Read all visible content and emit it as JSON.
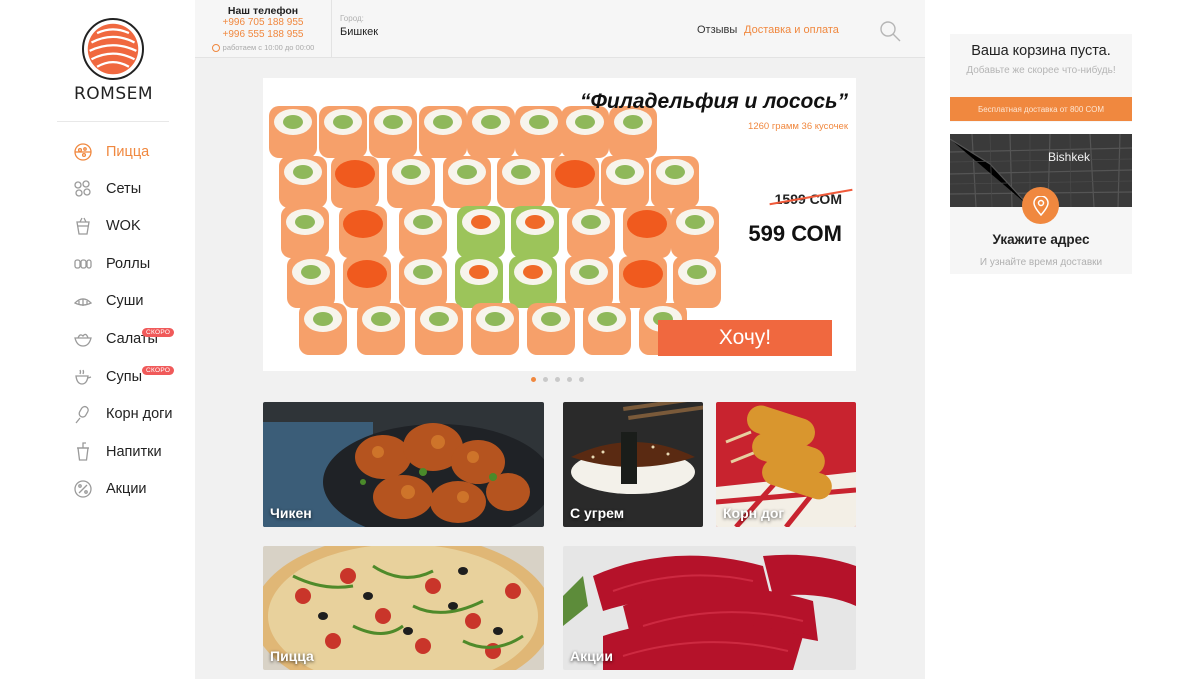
{
  "brand": {
    "name": "ROMSEM"
  },
  "sidebar": {
    "items": [
      {
        "label": "Пицца",
        "icon": "pizza-icon",
        "active": true
      },
      {
        "label": "Сеты",
        "icon": "sets-icon"
      },
      {
        "label": "WOK",
        "icon": "wok-box-icon"
      },
      {
        "label": "Роллы",
        "icon": "rolls-icon"
      },
      {
        "label": "Суши",
        "icon": "sushi-icon"
      },
      {
        "label": "Салаты",
        "icon": "salad-icon",
        "badge": "СКОРО"
      },
      {
        "label": "Супы",
        "icon": "soup-icon",
        "badge": "СКОРО"
      },
      {
        "label": "Корн доги",
        "icon": "corn-dog-icon"
      },
      {
        "label": "Напитки",
        "icon": "drink-icon"
      },
      {
        "label": "Акции",
        "icon": "discount-icon"
      }
    ]
  },
  "header": {
    "phone_title": "Наш телефон",
    "phones": [
      "+996 705 188 955",
      "+996 555 188 955"
    ],
    "hours": "работаем с 10:00 до 00:00",
    "city_caption": "Город:",
    "city": "Бишкек",
    "links": {
      "reviews": "Отзывы",
      "delivery": "Доставка и оплата"
    }
  },
  "hero": {
    "title": "“Филадельфия и лосось”",
    "subtitle": "1260 грамм 36 кусочек",
    "old_price": "1599 СОМ",
    "new_price": "599 СОМ",
    "cta": "Хочу!",
    "slides_count": 5,
    "active_slide": 1
  },
  "categories": [
    {
      "label": "Чикен"
    },
    {
      "label": "С угрем"
    },
    {
      "label": "Корн дог"
    },
    {
      "label": "Пицца"
    },
    {
      "label": "Акции"
    }
  ],
  "cart": {
    "title": "Ваша корзина пуста.",
    "subtitle": "Добавьте же скорее что-нибудь!",
    "delivery_note": "Бесплатная доставка от 800 СОМ"
  },
  "address": {
    "map_city": "Bishkek",
    "title": "Укажите адрес",
    "subtitle": "И узнайте время доставки"
  },
  "colors": {
    "accent": "#f0883f",
    "cta": "#f0683f",
    "badge": "#f05a5a"
  }
}
